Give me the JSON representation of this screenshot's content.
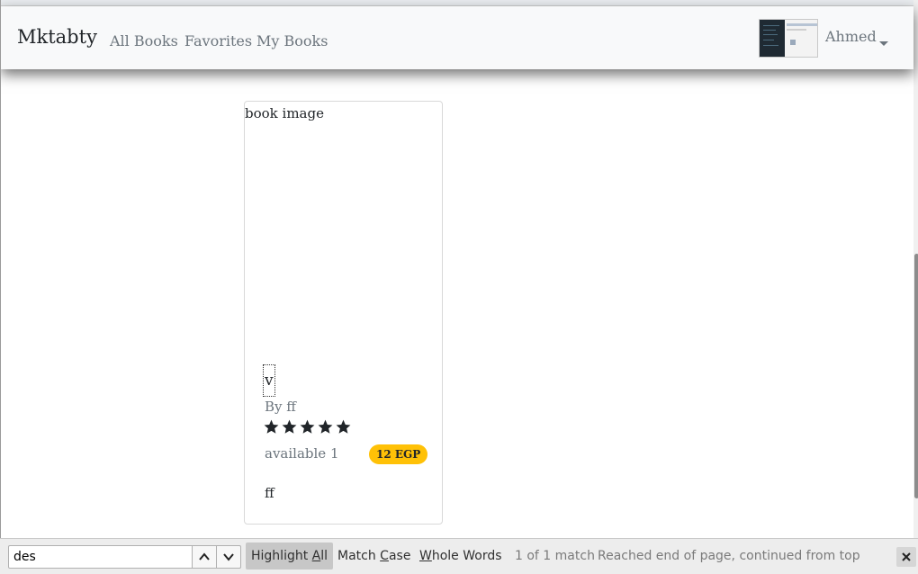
{
  "navbar": {
    "brand": "Mktabty",
    "links": [
      "All Books",
      "Favorites",
      "My Books"
    ],
    "user_name": "Ahmed"
  },
  "book_card": {
    "image_alt": "book image",
    "title": "v",
    "author": "By ff",
    "rating": 5,
    "rating_max": 5,
    "availability": "available 1",
    "price": "12 EGP",
    "description": "ff"
  },
  "find_bar": {
    "query": "des",
    "highlight_all": "Highlight All",
    "match_case": "Match Case",
    "whole_words": "Whole Words",
    "match_count": "1 of 1 match",
    "status": "Reached end of page, continued from top",
    "icons": {
      "previous": "chevron-up-icon",
      "next": "chevron-down-icon",
      "close": "close-icon"
    }
  },
  "colors": {
    "navbar_bg": "#f8f9fa",
    "badge": "#ffc107",
    "muted_text": "#6c757d",
    "star": "#212529"
  }
}
